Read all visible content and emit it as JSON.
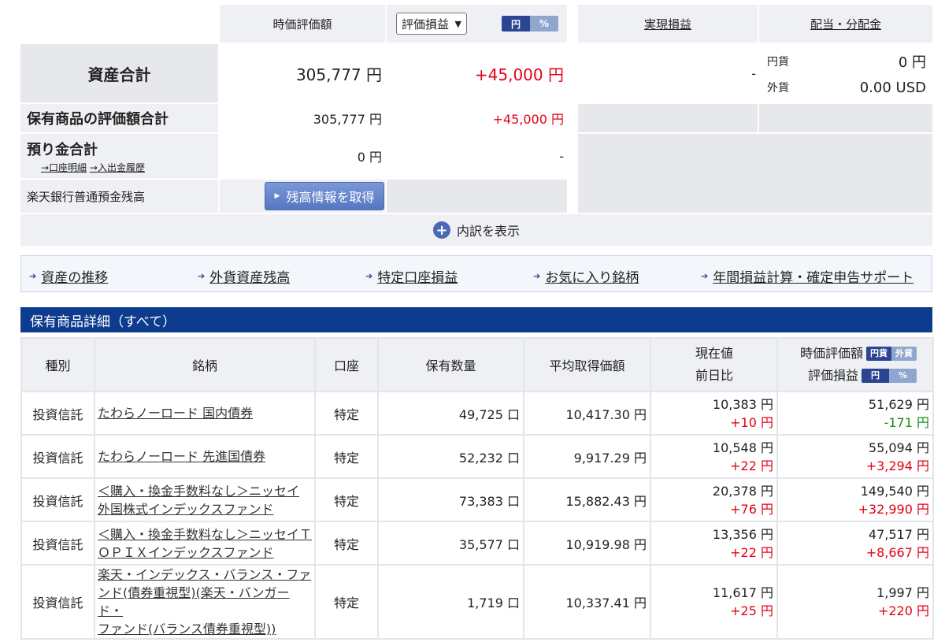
{
  "summary": {
    "col_market_value": "時価評価額",
    "profit_select": "評価損益",
    "toggle": [
      "円",
      "%"
    ],
    "col_realized": "実現損益",
    "col_dividend": "配当・分配金",
    "total_assets_label": "資産合計",
    "total_assets_value": "305,777 円",
    "total_assets_profit": "+45,000 円",
    "realized_value": "-",
    "dividend_jpy_label": "円貨",
    "dividend_jpy_value": "0 円",
    "dividend_fx_label": "外貨",
    "dividend_fx_value": "0.00 USD",
    "holdings_total_label": "保有商品の評価額合計",
    "holdings_total_value": "305,777 円",
    "holdings_total_profit": "+45,000 円",
    "deposit_label": "預り金合計",
    "deposit_link1": "→口座明細",
    "deposit_link2": "→入出金履歴",
    "deposit_value": "0 円",
    "deposit_profit": "-",
    "bank_label": "楽天銀行普通預金残高",
    "bank_button": "残高情報を取得",
    "breakdown_label": "内訳を表示"
  },
  "nav": [
    "資産の推移",
    "外貨資産残高",
    "特定口座損益",
    "お気に入り銘柄",
    "年間損益計算・確定申告サポート"
  ],
  "holdings": {
    "title": "保有商品詳細（すべて）",
    "headers": {
      "type": "種別",
      "name": "銘柄",
      "account": "口座",
      "quantity": "保有数量",
      "avg_cost": "平均取得価額",
      "price_line1": "現在値",
      "price_line2": "前日比",
      "value_line1": "時価評価額",
      "value_toggle": [
        "円貨",
        "外貨"
      ],
      "value_line2": "評価損益",
      "profit_toggle": [
        "円",
        "%"
      ]
    },
    "rows": [
      {
        "type": "投資信託",
        "name": [
          "たわらノーロード 国内債券"
        ],
        "account": "特定",
        "quantity": "49,725 口",
        "avg_cost": "10,417.30 円",
        "price": "10,383 円",
        "change": "+10 円",
        "value": "51,629 円",
        "profit": "-171 円",
        "profit_sign": "neg"
      },
      {
        "type": "投資信託",
        "name": [
          "たわらノーロード 先進国債券"
        ],
        "account": "特定",
        "quantity": "52,232 口",
        "avg_cost": "9,917.29 円",
        "price": "10,548 円",
        "change": "+22 円",
        "value": "55,094 円",
        "profit": "+3,294 円",
        "profit_sign": "pos"
      },
      {
        "type": "投資信託",
        "name": [
          "＜購入・換金手数料なし＞ニッセイ",
          "外国株式インデックスファンド"
        ],
        "account": "特定",
        "quantity": "73,383 口",
        "avg_cost": "15,882.43 円",
        "price": "20,378 円",
        "change": "+76 円",
        "value": "149,540 円",
        "profit": "+32,990 円",
        "profit_sign": "pos"
      },
      {
        "type": "投資信託",
        "name": [
          "＜購入・換金手数料なし＞ニッセイＴ",
          "ＯＰＩＸインデックスファンド"
        ],
        "account": "特定",
        "quantity": "35,577 口",
        "avg_cost": "10,919.98 円",
        "price": "13,356 円",
        "change": "+22 円",
        "value": "47,517 円",
        "profit": "+8,667 円",
        "profit_sign": "pos"
      },
      {
        "type": "投資信託",
        "name": [
          "楽天・インデックス・バランス・ファ",
          "ンド(債券重視型)(楽天・バンガード・",
          "ファンド(バランス債券重視型))"
        ],
        "account": "特定",
        "quantity": "1,719 口",
        "avg_cost": "10,337.41 円",
        "price": "11,617 円",
        "change": "+25 円",
        "value": "1,997 円",
        "profit": "+220 円",
        "profit_sign": "pos"
      }
    ]
  },
  "colors": {
    "navy": "#0d3b8e",
    "red": "#e60012",
    "green": "#1a8a1a",
    "toggle_on": "#2b4592",
    "toggle_off": "#8fa7cf"
  }
}
